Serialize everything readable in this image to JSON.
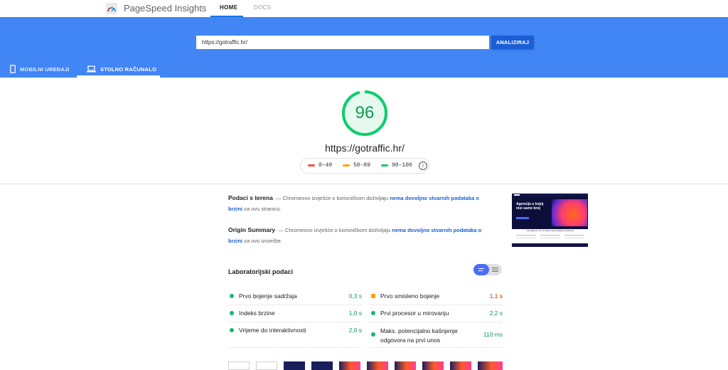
{
  "header": {
    "app_name": "PageSpeed Insights",
    "nav": [
      {
        "label": "HOME"
      },
      {
        "label": "DOCS"
      }
    ]
  },
  "search": {
    "value": "https://gotraffic.hr/",
    "button_label": "ANALIZIRAJ"
  },
  "device_tabs": [
    {
      "label": "MOBILNI UREĐAJI"
    },
    {
      "label": "STOLNO RAČUNALO"
    }
  ],
  "score": {
    "value": "96",
    "fraction": 0.96,
    "color": "#0cce6b",
    "url": "https://gotraffic.hr/"
  },
  "legend": [
    {
      "label": "0–49",
      "color": "#ff4e42"
    },
    {
      "label": "50–89",
      "color": "#ffa400"
    },
    {
      "label": "90–100",
      "color": "#0cce6b"
    }
  ],
  "field_data": {
    "title": "Podaci s terena",
    "text_before": "— Chromeovo izvješće o korisničkom doživljaju",
    "link": "nema dovoljno stvarnih podataka o brzini",
    "text_after": "za ovu stranicu."
  },
  "origin_summary": {
    "title": "Origin Summary",
    "text_before": "— Chromeovo izvješće o korisničkom doživljaju",
    "link": "nema dovoljno stvarnih podataka o brzini",
    "text_after": "za ovo izvorište."
  },
  "lab": {
    "title": "Laboratorijski podaci",
    "metrics_left": [
      {
        "name": "Prvo bojenje sadržaja",
        "value": "0,3 s",
        "status": "good"
      },
      {
        "name": "Indeks brzine",
        "value": "1,0 s",
        "status": "good"
      },
      {
        "name": "Vrijeme do interaktivnosti",
        "value": "2,0 s",
        "status": "good"
      }
    ],
    "metrics_right": [
      {
        "name": "Prvo smisleno bojenje",
        "value": "1,1 s",
        "status": "average"
      },
      {
        "name": "Prvi procesor u mirovanju",
        "value": "2,2 s",
        "status": "good"
      },
      {
        "name": "Maks. potencijalno kašnjenje odgovora na prvi unos",
        "value": "110 ms",
        "status": "good"
      }
    ]
  },
  "thumbnail": {
    "headline": "Agencija u kojoj nisi samo broj",
    "subheadline": "Specijalizirani smo za različite usluge digitalnog marketinga"
  },
  "colors": {
    "hero_blue": "#4285f4",
    "good": "#0cce6b",
    "average": "#ffa400",
    "poor": "#ff4e42"
  }
}
